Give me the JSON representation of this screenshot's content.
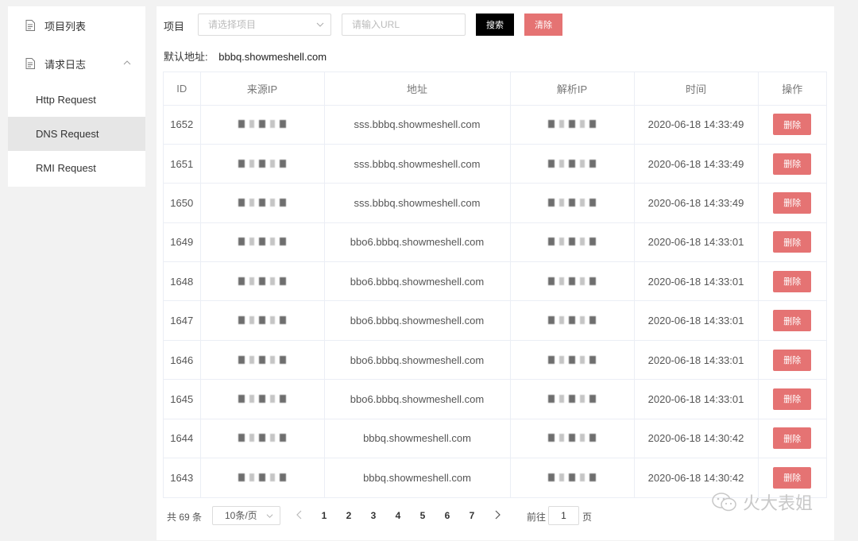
{
  "sidebar": {
    "items": [
      {
        "label": "项目列表",
        "icon": "document-icon"
      },
      {
        "label": "请求日志",
        "icon": "document-icon",
        "expanded": true
      }
    ],
    "submenu": [
      {
        "label": "Http Request",
        "active": false
      },
      {
        "label": "DNS Request",
        "active": true
      },
      {
        "label": "RMI Request",
        "active": false
      }
    ]
  },
  "toolbar": {
    "project_label": "项目",
    "project_placeholder": "请选择项目",
    "url_placeholder": "请输入URL",
    "search_label": "搜索",
    "clear_label": "清除"
  },
  "default_address": {
    "label": "默认地址:",
    "value": "bbbq.showmeshell.com"
  },
  "table": {
    "headers": [
      "ID",
      "来源IP",
      "地址",
      "解析IP",
      "时间",
      "操作"
    ],
    "delete_label": "删除",
    "rows": [
      {
        "id": "1652",
        "address": "sss.bbbq.showmeshell.com",
        "time": "2020-06-18 14:33:49"
      },
      {
        "id": "1651",
        "address": "sss.bbbq.showmeshell.com",
        "time": "2020-06-18 14:33:49"
      },
      {
        "id": "1650",
        "address": "sss.bbbq.showmeshell.com",
        "time": "2020-06-18 14:33:49"
      },
      {
        "id": "1649",
        "address": "bbo6.bbbq.showmeshell.com",
        "time": "2020-06-18 14:33:01"
      },
      {
        "id": "1648",
        "address": "bbo6.bbbq.showmeshell.com",
        "time": "2020-06-18 14:33:01"
      },
      {
        "id": "1647",
        "address": "bbo6.bbbq.showmeshell.com",
        "time": "2020-06-18 14:33:01"
      },
      {
        "id": "1646",
        "address": "bbo6.bbbq.showmeshell.com",
        "time": "2020-06-18 14:33:01"
      },
      {
        "id": "1645",
        "address": "bbo6.bbbq.showmeshell.com",
        "time": "2020-06-18 14:33:01"
      },
      {
        "id": "1644",
        "address": "bbbq.showmeshell.com",
        "time": "2020-06-18 14:30:42"
      },
      {
        "id": "1643",
        "address": "bbbq.showmeshell.com",
        "time": "2020-06-18 14:30:42"
      }
    ]
  },
  "pagination": {
    "total_text": "共 69 条",
    "page_size": "10条/页",
    "pages": [
      "1",
      "2",
      "3",
      "4",
      "5",
      "6",
      "7"
    ],
    "current_page": "1",
    "goto_label": "前往",
    "goto_value": "1",
    "page_unit": "页"
  },
  "watermark": "火大表姐",
  "colors": {
    "accent_red": "#e57373",
    "search_button": "#000000",
    "active_menu_bg": "#e6e6e6"
  }
}
